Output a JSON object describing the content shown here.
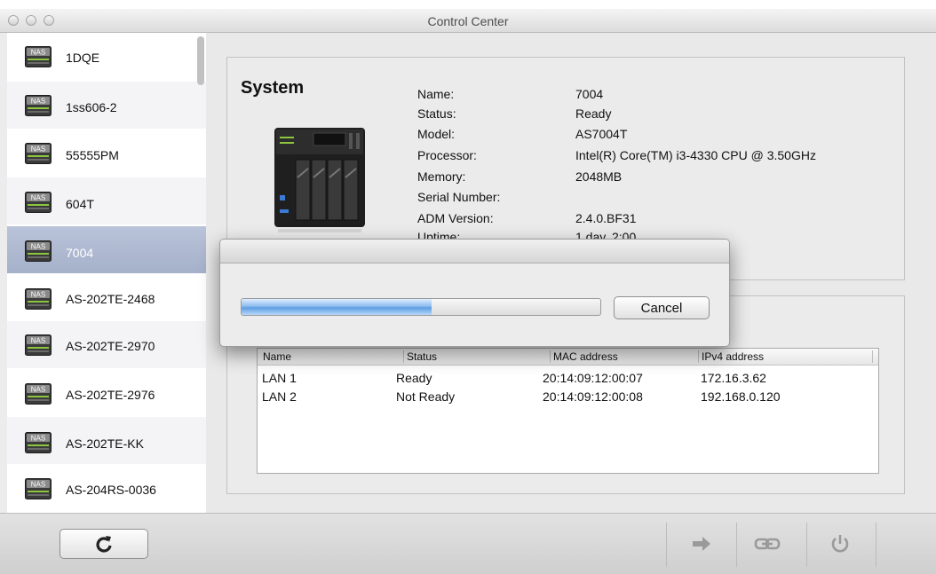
{
  "window": {
    "title": "Control Center"
  },
  "sidebar": {
    "items": [
      {
        "label": "1DQE",
        "icon": "nas-icon"
      },
      {
        "label": "1ss606-2",
        "icon": "nas-icon"
      },
      {
        "label": "55555PM",
        "icon": "nas-icon"
      },
      {
        "label": "604T",
        "icon": "nas-icon"
      },
      {
        "label": "7004",
        "icon": "nas-icon",
        "selected": true
      },
      {
        "label": "AS-202TE-2468",
        "icon": "nas-icon"
      },
      {
        "label": "AS-202TE-2970",
        "icon": "nas-icon"
      },
      {
        "label": "AS-202TE-2976",
        "icon": "nas-icon"
      },
      {
        "label": "AS-202TE-KK",
        "icon": "nas-icon"
      },
      {
        "label": "AS-204RS-0036",
        "icon": "nas-icon"
      }
    ]
  },
  "system": {
    "title": "System",
    "fields": [
      {
        "label": "Name:",
        "value": "7004"
      },
      {
        "label": "Status:",
        "value": "Ready"
      },
      {
        "label": "Model:",
        "value": "AS7004T"
      },
      {
        "label": "Processor:",
        "value": "Intel(R) Core(TM) i3-4330 CPU @ 3.50GHz"
      },
      {
        "label": "Memory:",
        "value": "2048MB"
      },
      {
        "label": "Serial Number:",
        "value": ""
      },
      {
        "label": "ADM Version:",
        "value": "2.4.0.BF31"
      },
      {
        "label": "Uptime:",
        "value": "1 day, 2:00"
      }
    ]
  },
  "network": {
    "columns": [
      "Name",
      "Status",
      "MAC address",
      "IPv4 address"
    ],
    "rows": [
      [
        "LAN 1",
        "Ready",
        "20:14:09:12:00:07",
        "172.16.3.62"
      ],
      [
        "LAN 2",
        "Not Ready",
        "20:14:09:12:00:08",
        "192.168.0.120"
      ]
    ]
  },
  "dialog": {
    "progress": 0.53,
    "cancel_label": "Cancel"
  },
  "toolbar": {
    "icons": [
      "refresh-icon",
      "arrow-right-icon",
      "link-icon",
      "power-icon"
    ]
  },
  "colors": {
    "selected_row": "#a5b1ca",
    "progress_blue": "#5f9ee2"
  }
}
